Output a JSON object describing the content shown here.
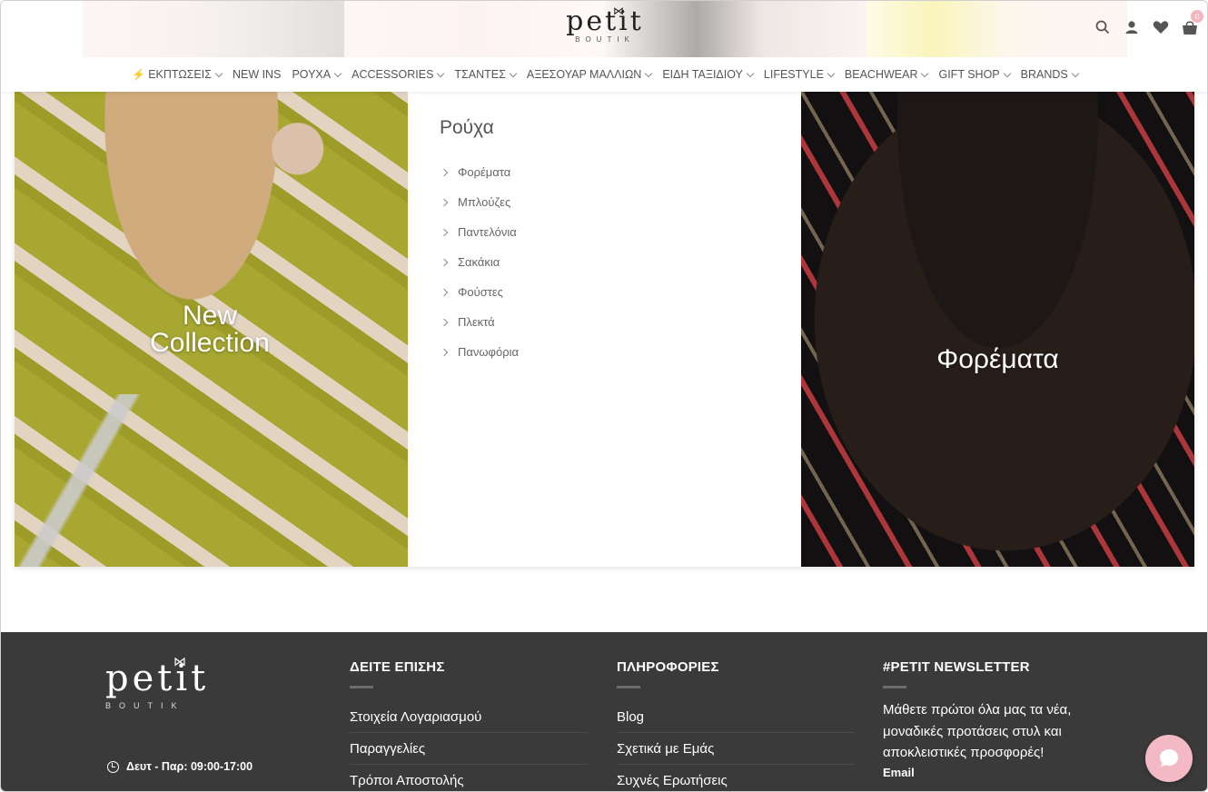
{
  "brand": {
    "logo_word": "petit",
    "logo_sub": "BOUTIK"
  },
  "header": {
    "cart_count": "0",
    "icons": [
      "search-icon",
      "user-icon",
      "heart-icon",
      "shopping-bag-icon"
    ]
  },
  "nav": [
    {
      "label": "ΕΚΠΤΩΣΕΙΣ",
      "has_dropdown": true,
      "icon": "bolt-icon"
    },
    {
      "label": "NEW INS",
      "has_dropdown": false
    },
    {
      "label": "ΡΟΥΧΑ",
      "has_dropdown": true
    },
    {
      "label": "ACCESSORIES",
      "has_dropdown": true
    },
    {
      "label": "ΤΣΑΝΤΕΣ",
      "has_dropdown": true
    },
    {
      "label": "ΑΞΕΣΟΥΑΡ ΜΑΛΛΙΩΝ",
      "has_dropdown": true
    },
    {
      "label": "ΕΙΔΗ ΤΑΞΙΔΙΟΥ",
      "has_dropdown": true
    },
    {
      "label": "LIFESTYLE",
      "has_dropdown": true
    },
    {
      "label": "BEACHWEAR",
      "has_dropdown": true
    },
    {
      "label": "GIFT SHOP",
      "has_dropdown": true
    },
    {
      "label": "BRANDS",
      "has_dropdown": true
    }
  ],
  "mega_menu": {
    "left_caption_line1": "New",
    "left_caption_line2": "Collection",
    "title": "Ρούχα",
    "items": [
      "Φορέματα",
      "Μπλούζες",
      "Παντελόνια",
      "Σακάκια",
      "Φούστες",
      "Πλεκτά",
      "Πανωφόρια"
    ],
    "right_caption": "Φορέματα"
  },
  "footer": {
    "hours": "Δευτ - Παρ: 09:00-17:00",
    "col1": {
      "title": "ΔΕΙΤΕ ΕΠΙΣΗΣ",
      "links": [
        "Στοιχεία Λογαριασμού",
        "Παραγγελίες",
        "Τρόποι Αποστολής"
      ]
    },
    "col2": {
      "title": "ΠΛΗΡΟΦΟΡΙΕΣ",
      "links": [
        "Blog",
        "Σχετικά με Εμάς",
        "Συχνές Ερωτήσεις"
      ]
    },
    "col3": {
      "title": "#PETIT NEWSLETTER",
      "text": "Μάθετε πρώτοι όλα μας τα νέα, μοναδικές προτάσεις στυλ και αποκλειστικές προσφορές!",
      "email_label": "Email"
    }
  },
  "colors": {
    "footer_bg": "#3a3a3a",
    "chat_bubble": "#f3b9c4",
    "accent_bolt": "#e8742c"
  }
}
